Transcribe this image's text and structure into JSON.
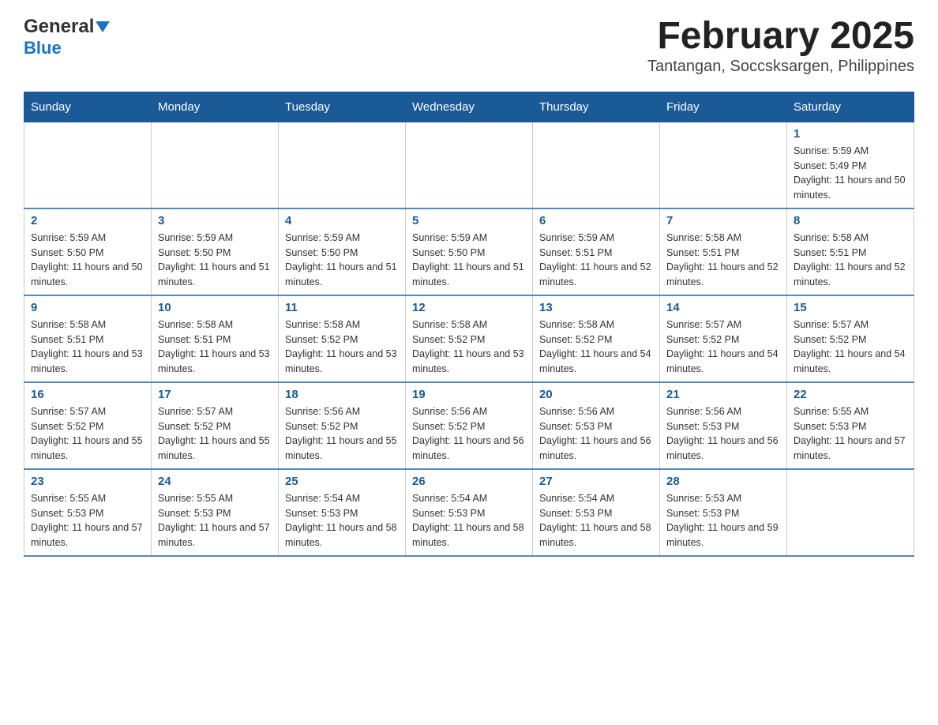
{
  "header": {
    "logo_general": "General",
    "logo_blue": "Blue",
    "title": "February 2025",
    "subtitle": "Tantangan, Soccsksargen, Philippines"
  },
  "weekdays": [
    "Sunday",
    "Monday",
    "Tuesday",
    "Wednesday",
    "Thursday",
    "Friday",
    "Saturday"
  ],
  "weeks": [
    [
      {
        "day": "",
        "sunrise": "",
        "sunset": "",
        "daylight": ""
      },
      {
        "day": "",
        "sunrise": "",
        "sunset": "",
        "daylight": ""
      },
      {
        "day": "",
        "sunrise": "",
        "sunset": "",
        "daylight": ""
      },
      {
        "day": "",
        "sunrise": "",
        "sunset": "",
        "daylight": ""
      },
      {
        "day": "",
        "sunrise": "",
        "sunset": "",
        "daylight": ""
      },
      {
        "day": "",
        "sunrise": "",
        "sunset": "",
        "daylight": ""
      },
      {
        "day": "1",
        "sunrise": "Sunrise: 5:59 AM",
        "sunset": "Sunset: 5:49 PM",
        "daylight": "Daylight: 11 hours and 50 minutes."
      }
    ],
    [
      {
        "day": "2",
        "sunrise": "Sunrise: 5:59 AM",
        "sunset": "Sunset: 5:50 PM",
        "daylight": "Daylight: 11 hours and 50 minutes."
      },
      {
        "day": "3",
        "sunrise": "Sunrise: 5:59 AM",
        "sunset": "Sunset: 5:50 PM",
        "daylight": "Daylight: 11 hours and 51 minutes."
      },
      {
        "day": "4",
        "sunrise": "Sunrise: 5:59 AM",
        "sunset": "Sunset: 5:50 PM",
        "daylight": "Daylight: 11 hours and 51 minutes."
      },
      {
        "day": "5",
        "sunrise": "Sunrise: 5:59 AM",
        "sunset": "Sunset: 5:50 PM",
        "daylight": "Daylight: 11 hours and 51 minutes."
      },
      {
        "day": "6",
        "sunrise": "Sunrise: 5:59 AM",
        "sunset": "Sunset: 5:51 PM",
        "daylight": "Daylight: 11 hours and 52 minutes."
      },
      {
        "day": "7",
        "sunrise": "Sunrise: 5:58 AM",
        "sunset": "Sunset: 5:51 PM",
        "daylight": "Daylight: 11 hours and 52 minutes."
      },
      {
        "day": "8",
        "sunrise": "Sunrise: 5:58 AM",
        "sunset": "Sunset: 5:51 PM",
        "daylight": "Daylight: 11 hours and 52 minutes."
      }
    ],
    [
      {
        "day": "9",
        "sunrise": "Sunrise: 5:58 AM",
        "sunset": "Sunset: 5:51 PM",
        "daylight": "Daylight: 11 hours and 53 minutes."
      },
      {
        "day": "10",
        "sunrise": "Sunrise: 5:58 AM",
        "sunset": "Sunset: 5:51 PM",
        "daylight": "Daylight: 11 hours and 53 minutes."
      },
      {
        "day": "11",
        "sunrise": "Sunrise: 5:58 AM",
        "sunset": "Sunset: 5:52 PM",
        "daylight": "Daylight: 11 hours and 53 minutes."
      },
      {
        "day": "12",
        "sunrise": "Sunrise: 5:58 AM",
        "sunset": "Sunset: 5:52 PM",
        "daylight": "Daylight: 11 hours and 53 minutes."
      },
      {
        "day": "13",
        "sunrise": "Sunrise: 5:58 AM",
        "sunset": "Sunset: 5:52 PM",
        "daylight": "Daylight: 11 hours and 54 minutes."
      },
      {
        "day": "14",
        "sunrise": "Sunrise: 5:57 AM",
        "sunset": "Sunset: 5:52 PM",
        "daylight": "Daylight: 11 hours and 54 minutes."
      },
      {
        "day": "15",
        "sunrise": "Sunrise: 5:57 AM",
        "sunset": "Sunset: 5:52 PM",
        "daylight": "Daylight: 11 hours and 54 minutes."
      }
    ],
    [
      {
        "day": "16",
        "sunrise": "Sunrise: 5:57 AM",
        "sunset": "Sunset: 5:52 PM",
        "daylight": "Daylight: 11 hours and 55 minutes."
      },
      {
        "day": "17",
        "sunrise": "Sunrise: 5:57 AM",
        "sunset": "Sunset: 5:52 PM",
        "daylight": "Daylight: 11 hours and 55 minutes."
      },
      {
        "day": "18",
        "sunrise": "Sunrise: 5:56 AM",
        "sunset": "Sunset: 5:52 PM",
        "daylight": "Daylight: 11 hours and 55 minutes."
      },
      {
        "day": "19",
        "sunrise": "Sunrise: 5:56 AM",
        "sunset": "Sunset: 5:52 PM",
        "daylight": "Daylight: 11 hours and 56 minutes."
      },
      {
        "day": "20",
        "sunrise": "Sunrise: 5:56 AM",
        "sunset": "Sunset: 5:53 PM",
        "daylight": "Daylight: 11 hours and 56 minutes."
      },
      {
        "day": "21",
        "sunrise": "Sunrise: 5:56 AM",
        "sunset": "Sunset: 5:53 PM",
        "daylight": "Daylight: 11 hours and 56 minutes."
      },
      {
        "day": "22",
        "sunrise": "Sunrise: 5:55 AM",
        "sunset": "Sunset: 5:53 PM",
        "daylight": "Daylight: 11 hours and 57 minutes."
      }
    ],
    [
      {
        "day": "23",
        "sunrise": "Sunrise: 5:55 AM",
        "sunset": "Sunset: 5:53 PM",
        "daylight": "Daylight: 11 hours and 57 minutes."
      },
      {
        "day": "24",
        "sunrise": "Sunrise: 5:55 AM",
        "sunset": "Sunset: 5:53 PM",
        "daylight": "Daylight: 11 hours and 57 minutes."
      },
      {
        "day": "25",
        "sunrise": "Sunrise: 5:54 AM",
        "sunset": "Sunset: 5:53 PM",
        "daylight": "Daylight: 11 hours and 58 minutes."
      },
      {
        "day": "26",
        "sunrise": "Sunrise: 5:54 AM",
        "sunset": "Sunset: 5:53 PM",
        "daylight": "Daylight: 11 hours and 58 minutes."
      },
      {
        "day": "27",
        "sunrise": "Sunrise: 5:54 AM",
        "sunset": "Sunset: 5:53 PM",
        "daylight": "Daylight: 11 hours and 58 minutes."
      },
      {
        "day": "28",
        "sunrise": "Sunrise: 5:53 AM",
        "sunset": "Sunset: 5:53 PM",
        "daylight": "Daylight: 11 hours and 59 minutes."
      },
      {
        "day": "",
        "sunrise": "",
        "sunset": "",
        "daylight": ""
      }
    ]
  ]
}
